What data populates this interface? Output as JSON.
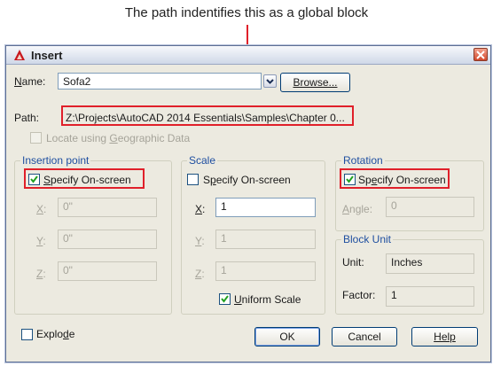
{
  "caption": "The path indentifies this as a global block",
  "dialog": {
    "title": "Insert",
    "name_label": "Name:",
    "name_value": "Sofa2",
    "browse_label": "Browse...",
    "path_label": "Path:",
    "path_value": "Z:\\Projects\\AutoCAD 2014 Essentials\\Samples\\Chapter 0...",
    "geo_label": "Locate using Geographic Data",
    "insertion": {
      "title": "Insertion point",
      "specify": "Specify On-screen",
      "x_label": "X:",
      "x_value": "0\"",
      "y_label": "Y:",
      "y_value": "0\"",
      "z_label": "Z:",
      "z_value": "0\""
    },
    "scale": {
      "title": "Scale",
      "specify": "Specify On-screen",
      "x_label": "X:",
      "x_value": "1",
      "y_label": "Y:",
      "y_value": "1",
      "z_label": "Z:",
      "z_value": "1",
      "uniform": "Uniform Scale"
    },
    "rotation": {
      "title": "Rotation",
      "specify": "Specify On-screen",
      "angle_label": "Angle:",
      "angle_value": "0"
    },
    "block_unit": {
      "title": "Block Unit",
      "unit_label": "Unit:",
      "unit_value": "Inches",
      "factor_label": "Factor:",
      "factor_value": "1"
    },
    "explode_label": "Explode",
    "ok_label": "OK",
    "cancel_label": "Cancel",
    "help_label": "Help"
  },
  "colors": {
    "annotation": "#e0202a",
    "group_title": "#1f4fa0",
    "dialog_bg": "#eceae0"
  }
}
